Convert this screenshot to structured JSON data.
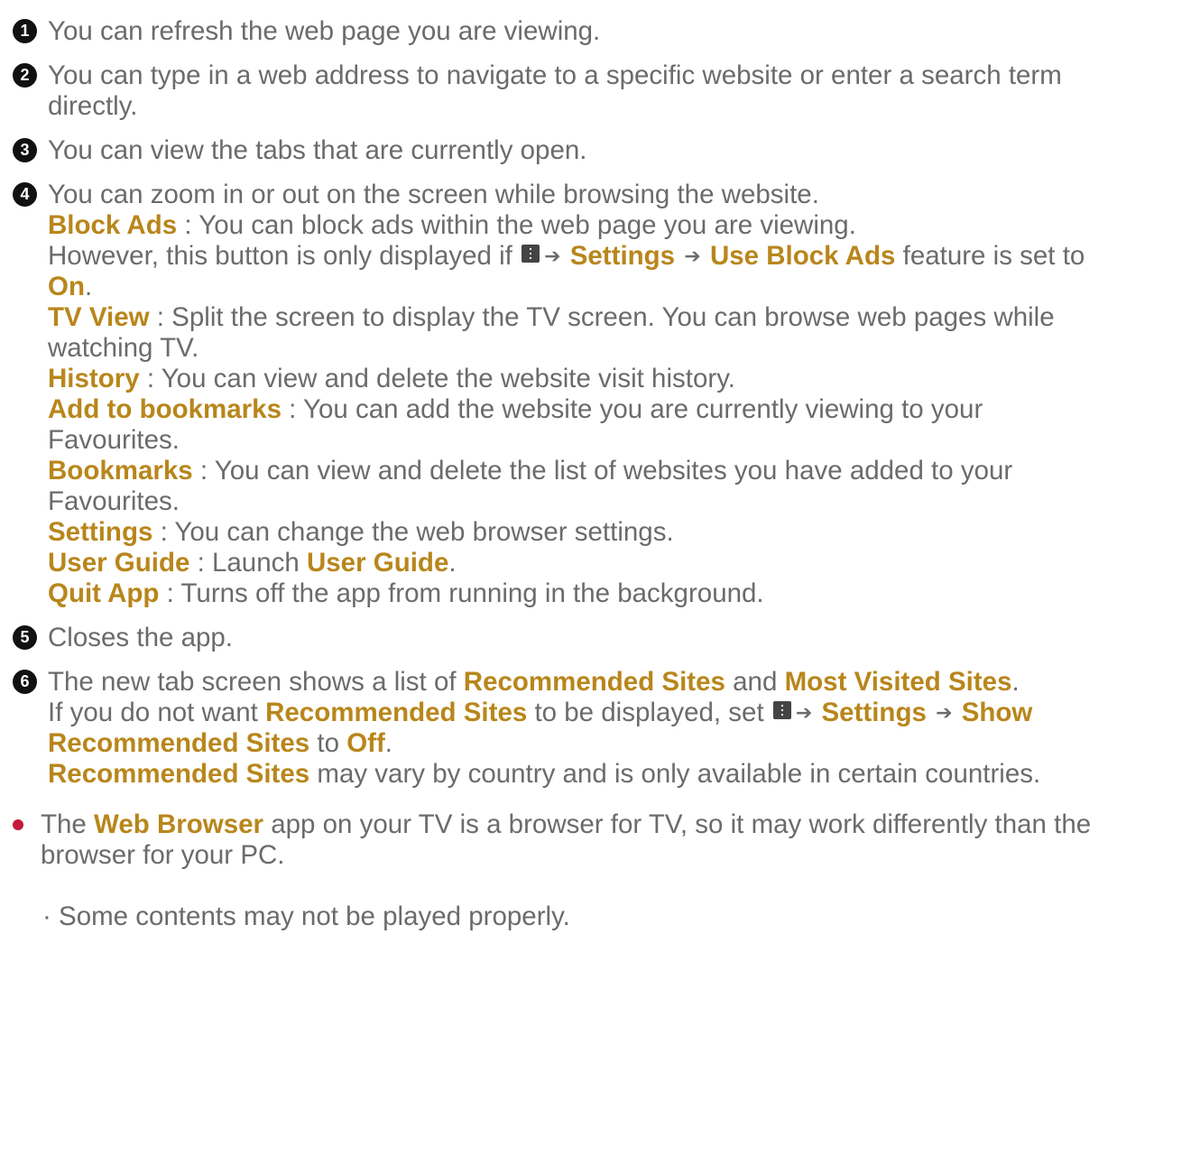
{
  "items": [
    {
      "num": "1",
      "text": "You can refresh the web page you are viewing."
    },
    {
      "num": "2",
      "line1": "You can type in a web address to navigate to a specific website or enter a search term",
      "line2": "directly."
    },
    {
      "num": "3",
      "text": "You can view the tabs that are currently open."
    },
    {
      "num": "4",
      "text": "You can zoom in or out on the screen while browsing the website."
    },
    {
      "num": "5",
      "text": "Closes the app."
    },
    {
      "num": "6"
    }
  ],
  "menu4": {
    "block_ads": "Block Ads",
    "block_ads_desc": " : You can block ads within the web page you are viewing.",
    "however_pre": "However, this button is only displayed if ",
    "settings": "Settings",
    "use_block_ads": "Use Block Ads",
    "feature_set_to": " feature is set to",
    "on": "On",
    "period": ".",
    "tv_view": "TV View",
    "tv_view_desc1": " : Split the screen to display the TV screen. You can browse web pages while",
    "tv_view_desc2": "watching TV.",
    "history": "History",
    "history_desc": " : You can view and delete the website visit history.",
    "add_bookmarks": "Add to bookmarks",
    "add_bookmarks_desc1": " : You can add the website you are currently viewing to your",
    "add_bookmarks_desc2": "Favourites.",
    "bookmarks": "Bookmarks",
    "bookmarks_desc1": " : You can view and delete the list of websites you have added to your",
    "bookmarks_desc2": "Favourites.",
    "settings_item": "Settings",
    "settings_desc": " : You can change the web browser settings.",
    "user_guide": "User Guide",
    "user_guide_desc": " : Launch ",
    "user_guide_link": "User Guide",
    "quit_app": "Quit App",
    "quit_app_desc": " : Turns off the app from running in the background."
  },
  "item6": {
    "l1_pre": "The new tab screen shows a list of ",
    "recommended": "Recommended Sites",
    "and": " and ",
    "most_visited": "Most Visited Sites",
    "period": ".",
    "l2_pre": "If you do not want ",
    "l2_mid": " to be displayed, set ",
    "settings": "Settings",
    "show": "Show",
    "show_recommended": "Recommended Sites",
    "to": " to ",
    "off": "Off",
    "l4_bold": "Recommended Sites",
    "l4_rest": " may vary by country and is only available in certain countries."
  },
  "note": {
    "pre": "The ",
    "web_browser": "Web Browser",
    "rest1": " app on your TV is a browser for TV, so it may work differently than the",
    "rest2": "browser for your PC."
  },
  "sub": {
    "text": "· Some contents may not be played properly."
  },
  "colors": {
    "accent": "#b8861b",
    "text": "#6b6b6b",
    "bullet": "#c4193c"
  }
}
